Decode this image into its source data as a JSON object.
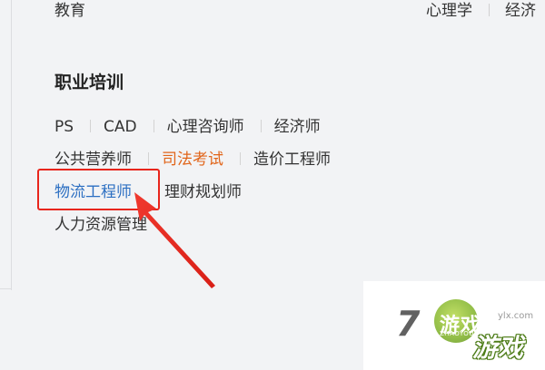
{
  "top_row": {
    "left_text": "教育",
    "right_items": [
      "心理学",
      "经济"
    ]
  },
  "section": {
    "title": "职业培训"
  },
  "links": {
    "row1": [
      "PS",
      "CAD",
      "心理咨询师",
      "经济师"
    ],
    "row2": [
      "公共营养师",
      "司法考试",
      "造价工程师"
    ],
    "row3": [
      "物流工程师",
      "理财规划师"
    ],
    "row4": [
      "人力资源管理"
    ]
  },
  "colors": {
    "highlight_box": "#e8251c",
    "active_link": "#2c6fc2",
    "hover_link": "#e1651a"
  },
  "watermark": {
    "number": "7",
    "brand": "游戏",
    "pinyin": "ZHAOYOUXIWANG",
    "game": "游戏",
    "domain": "ylx.com"
  }
}
